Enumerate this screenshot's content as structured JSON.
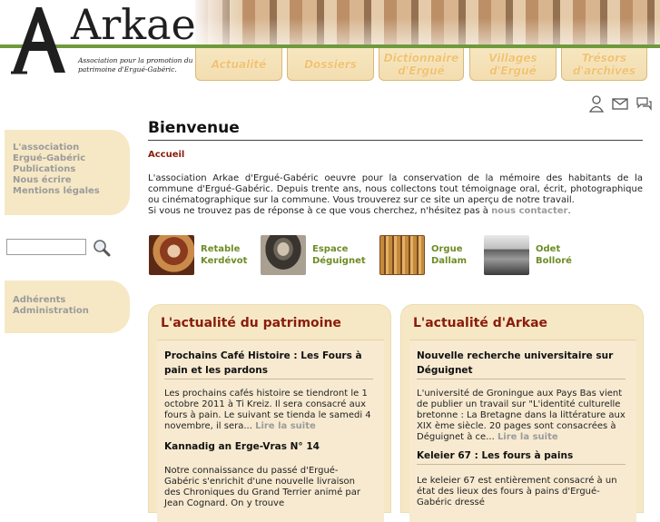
{
  "header": {
    "logo_text": "Arkae",
    "logo_subtitle": "Association pour la promotion du patrimoine d'Ergué-Gabéric.",
    "nav": [
      {
        "label": "Actualité"
      },
      {
        "label": "Dossiers"
      },
      {
        "label": "Dictionnaire d'Ergué"
      },
      {
        "label": "Villages d'Ergué"
      },
      {
        "label": "Trésors d'archives"
      }
    ]
  },
  "sidebar": {
    "main_links": [
      {
        "label": "L'association"
      },
      {
        "label": "Ergué-Gabéric"
      },
      {
        "label": "Publications"
      },
      {
        "label": "Nous écrire"
      },
      {
        "label": "Mentions légales"
      }
    ],
    "search_placeholder": "",
    "member_links": [
      {
        "label": "Adhérents"
      },
      {
        "label": "Administration"
      }
    ]
  },
  "main": {
    "title": "Bienvenue",
    "breadcrumb": "Accueil",
    "intro_text": "L'association Arkae d'Ergué-Gabéric oeuvre pour la conservation de la mémoire des habitants de la commune d'Ergué-Gabéric. Depuis trente ans, nous collectons tout témoignage oral, écrit, photographique ou cinématographique sur la commune. Vous trouverez sur ce site un aperçu de notre travail.",
    "intro_text2": "Si vous ne trouvez pas de réponse à ce que vous cherchez, n'hésitez pas à ",
    "contact_link": "nous contacter",
    "intro_end": ".",
    "featured": [
      {
        "line1": "Retable",
        "line2": "Kerdévot"
      },
      {
        "line1": "Espace",
        "line2": "Déguignet"
      },
      {
        "line1": "Orgue",
        "line2": "Dallam"
      },
      {
        "line1": "Odet",
        "line2": "Bolloré"
      }
    ]
  },
  "news_patrimoine": {
    "title": "L'actualité du patrimoine",
    "articles": [
      {
        "title": "Prochains Café Histoire : Les Fours à pain et les pardons",
        "body": "Les prochains cafés histoire se tiendront le 1 octobre 2011 à Ti Kreiz. Il sera consacré aux fours à pain. Le suivant se tienda le samedi 4 novembre, il sera...",
        "more": "Lire la suite"
      },
      {
        "title": "Kannadig an Erge-Vras N° 14",
        "body": "Notre connaissance du passé d'Ergué-Gabéric s'enrichit d'une nouvelle livraison des Chroniques du Grand Terrier animé par Jean Cognard. On y trouve",
        "more": ""
      }
    ]
  },
  "news_arkae": {
    "title": "L'actualité d'Arkae",
    "articles": [
      {
        "title": "Nouvelle recherche universitaire sur Déguignet",
        "body": "L'université de Groningue aux Pays Bas vient de publier un travail sur \"L'identité culturelle bretonne : La Bretagne dans la littérature aux XIX ème siècle. 20 pages sont consacrées à Déguignet à ce...",
        "more": "Lire la suite"
      },
      {
        "title": "Keleier 67 : Les fours à pains",
        "body": "Le keleier 67 est entièrement consacré à un état des lieux des fours à pains d'Ergué-Gabéric dressé",
        "more": ""
      }
    ]
  },
  "colors": {
    "accent_red": "#8a1c0c",
    "accent_green": "#6e8c26",
    "panel_bg": "#f6e8c5",
    "tab_text": "#f1c270"
  },
  "icons": {
    "user": "user-icon",
    "mail": "mail-icon",
    "chat": "chat-icon",
    "search": "magnifier-icon"
  }
}
